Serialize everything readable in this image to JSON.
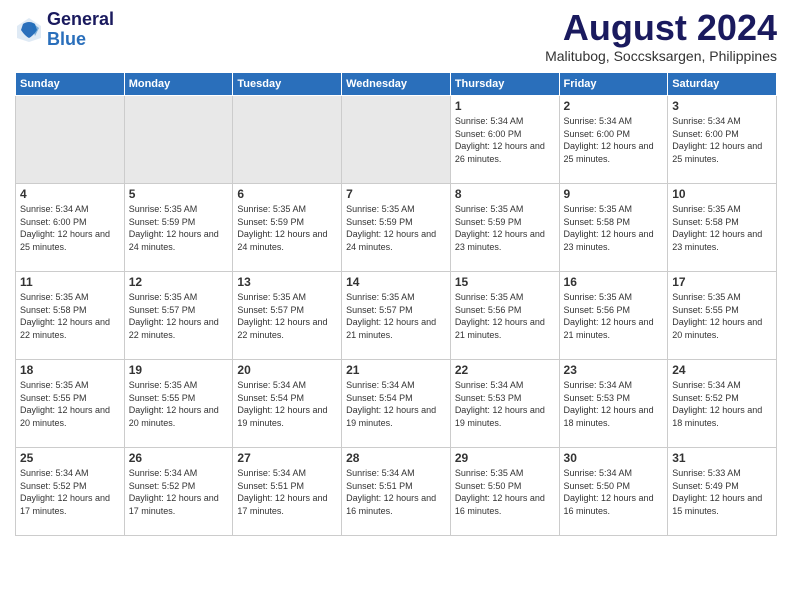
{
  "header": {
    "logo": {
      "line1": "General",
      "line2": "Blue"
    },
    "title": "August 2024",
    "location": "Malitubog, Soccsksargen, Philippines"
  },
  "weekdays": [
    "Sunday",
    "Monday",
    "Tuesday",
    "Wednesday",
    "Thursday",
    "Friday",
    "Saturday"
  ],
  "weeks": [
    [
      {
        "day": "",
        "empty": true
      },
      {
        "day": "",
        "empty": true
      },
      {
        "day": "",
        "empty": true
      },
      {
        "day": "",
        "empty": true
      },
      {
        "day": "1",
        "sunrise": "5:34 AM",
        "sunset": "6:00 PM",
        "daylight": "12 hours and 26 minutes"
      },
      {
        "day": "2",
        "sunrise": "5:34 AM",
        "sunset": "6:00 PM",
        "daylight": "12 hours and 25 minutes"
      },
      {
        "day": "3",
        "sunrise": "5:34 AM",
        "sunset": "6:00 PM",
        "daylight": "12 hours and 25 minutes"
      }
    ],
    [
      {
        "day": "4",
        "sunrise": "5:34 AM",
        "sunset": "6:00 PM",
        "daylight": "12 hours and 25 minutes"
      },
      {
        "day": "5",
        "sunrise": "5:35 AM",
        "sunset": "5:59 PM",
        "daylight": "12 hours and 24 minutes"
      },
      {
        "day": "6",
        "sunrise": "5:35 AM",
        "sunset": "5:59 PM",
        "daylight": "12 hours and 24 minutes"
      },
      {
        "day": "7",
        "sunrise": "5:35 AM",
        "sunset": "5:59 PM",
        "daylight": "12 hours and 24 minutes"
      },
      {
        "day": "8",
        "sunrise": "5:35 AM",
        "sunset": "5:59 PM",
        "daylight": "12 hours and 23 minutes"
      },
      {
        "day": "9",
        "sunrise": "5:35 AM",
        "sunset": "5:58 PM",
        "daylight": "12 hours and 23 minutes"
      },
      {
        "day": "10",
        "sunrise": "5:35 AM",
        "sunset": "5:58 PM",
        "daylight": "12 hours and 23 minutes"
      }
    ],
    [
      {
        "day": "11",
        "sunrise": "5:35 AM",
        "sunset": "5:58 PM",
        "daylight": "12 hours and 22 minutes"
      },
      {
        "day": "12",
        "sunrise": "5:35 AM",
        "sunset": "5:57 PM",
        "daylight": "12 hours and 22 minutes"
      },
      {
        "day": "13",
        "sunrise": "5:35 AM",
        "sunset": "5:57 PM",
        "daylight": "12 hours and 22 minutes"
      },
      {
        "day": "14",
        "sunrise": "5:35 AM",
        "sunset": "5:57 PM",
        "daylight": "12 hours and 21 minutes"
      },
      {
        "day": "15",
        "sunrise": "5:35 AM",
        "sunset": "5:56 PM",
        "daylight": "12 hours and 21 minutes"
      },
      {
        "day": "16",
        "sunrise": "5:35 AM",
        "sunset": "5:56 PM",
        "daylight": "12 hours and 21 minutes"
      },
      {
        "day": "17",
        "sunrise": "5:35 AM",
        "sunset": "5:55 PM",
        "daylight": "12 hours and 20 minutes"
      }
    ],
    [
      {
        "day": "18",
        "sunrise": "5:35 AM",
        "sunset": "5:55 PM",
        "daylight": "12 hours and 20 minutes"
      },
      {
        "day": "19",
        "sunrise": "5:35 AM",
        "sunset": "5:55 PM",
        "daylight": "12 hours and 20 minutes"
      },
      {
        "day": "20",
        "sunrise": "5:34 AM",
        "sunset": "5:54 PM",
        "daylight": "12 hours and 19 minutes"
      },
      {
        "day": "21",
        "sunrise": "5:34 AM",
        "sunset": "5:54 PM",
        "daylight": "12 hours and 19 minutes"
      },
      {
        "day": "22",
        "sunrise": "5:34 AM",
        "sunset": "5:53 PM",
        "daylight": "12 hours and 19 minutes"
      },
      {
        "day": "23",
        "sunrise": "5:34 AM",
        "sunset": "5:53 PM",
        "daylight": "12 hours and 18 minutes"
      },
      {
        "day": "24",
        "sunrise": "5:34 AM",
        "sunset": "5:52 PM",
        "daylight": "12 hours and 18 minutes"
      }
    ],
    [
      {
        "day": "25",
        "sunrise": "5:34 AM",
        "sunset": "5:52 PM",
        "daylight": "12 hours and 17 minutes"
      },
      {
        "day": "26",
        "sunrise": "5:34 AM",
        "sunset": "5:52 PM",
        "daylight": "12 hours and 17 minutes"
      },
      {
        "day": "27",
        "sunrise": "5:34 AM",
        "sunset": "5:51 PM",
        "daylight": "12 hours and 17 minutes"
      },
      {
        "day": "28",
        "sunrise": "5:34 AM",
        "sunset": "5:51 PM",
        "daylight": "12 hours and 16 minutes"
      },
      {
        "day": "29",
        "sunrise": "5:35 AM",
        "sunset": "5:50 PM",
        "daylight": "12 hours and 16 minutes"
      },
      {
        "day": "30",
        "sunrise": "5:34 AM",
        "sunset": "5:50 PM",
        "daylight": "12 hours and 16 minutes"
      },
      {
        "day": "31",
        "sunrise": "5:33 AM",
        "sunset": "5:49 PM",
        "daylight": "12 hours and 15 minutes"
      }
    ]
  ]
}
